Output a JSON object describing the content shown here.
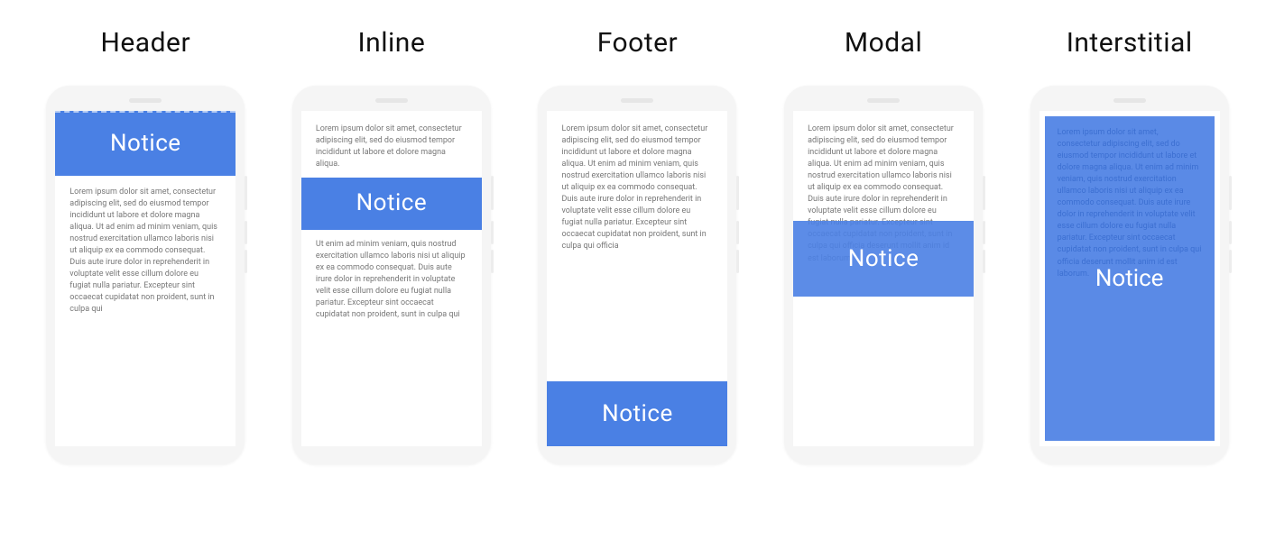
{
  "notice_label": "Notice",
  "columns": [
    {
      "title": "Header"
    },
    {
      "title": "Inline"
    },
    {
      "title": "Footer"
    },
    {
      "title": "Modal"
    },
    {
      "title": "Interstitial"
    }
  ],
  "lorem": {
    "short": "Lorem ipsum dolor sit amet, consectetur adipiscing elit, sed do eiusmod tempor incididunt ut labore et dolore magna aliqua.",
    "p1": "Lorem ipsum dolor sit amet, consectetur adipiscing elit, sed do eiusmod tempor incididunt ut labore et dolore magna aliqua. Ut ad enim ad minim veniam, quis nostrud exercitation ullamco laboris nisi ut aliquip ex ea commodo consequat. Duis aute irure dolor in reprehenderit in voluptate velit esse cillum dolore eu fugiat nulla pariatur. Excepteur sint occaecat cupidatat non proident, sunt in culpa qui",
    "p2": "Ut enim ad minim veniam, quis nostrud exercitation ullamco laboris nisi ut aliquip ex ea commodo consequat. Duis aute irure dolor in reprehenderit in voluptate velit esse cillum dolore eu fugiat nulla pariatur. Excepteur sint occaecat cupidatat non proident, sunt in culpa qui",
    "footer_body": "Lorem ipsum dolor sit amet, consectetur adipiscing elit, sed do eiusmod tempor incididunt ut labore et dolore magna aliqua. Ut enim ad minim veniam, quis nostrud exercitation ullamco laboris nisi ut aliquip ex ea commodo consequat. Duis aute irure dolor in reprehenderit in voluptate velit esse cillum dolore eu fugiat nulla pariatur. Excepteur sint occaecat cupidatat non proident, sunt in culpa qui officia",
    "modal_body": "Lorem ipsum dolor sit amet, consectetur adipiscing elit, sed do eiusmod tempor incididunt ut labore et dolore magna aliqua. Ut enim ad minim veniam, quis nostrud exercitation ullamco laboris nisi ut aliquip ex ea commodo consequat. Duis aute irure dolor in reprehenderit in voluptate velit esse cillum dolore eu fugiat nulla pariatur. Excepteur sint occaecat cupidatat non proident, sunt in culpa qui officia deserunt mollit anim id est laborum.",
    "interstitial_body": "Lorem ipsum dolor sit amet, consectetur adipiscing elit, sed do eiusmod tempor incididunt ut labore et dolore magna aliqua. Ut enim ad minim veniam, quis nostrud exercitation ullamco laboris nisi ut aliquip ex ea commodo consequat. Duis aute irure dolor in reprehenderit in voluptate velit esse cillum dolore eu fugiat nulla pariatur. Excepteur sint occaecat cupidatat non proident, sunt in culpa qui officia deserunt mollit anim id est laborum."
  }
}
